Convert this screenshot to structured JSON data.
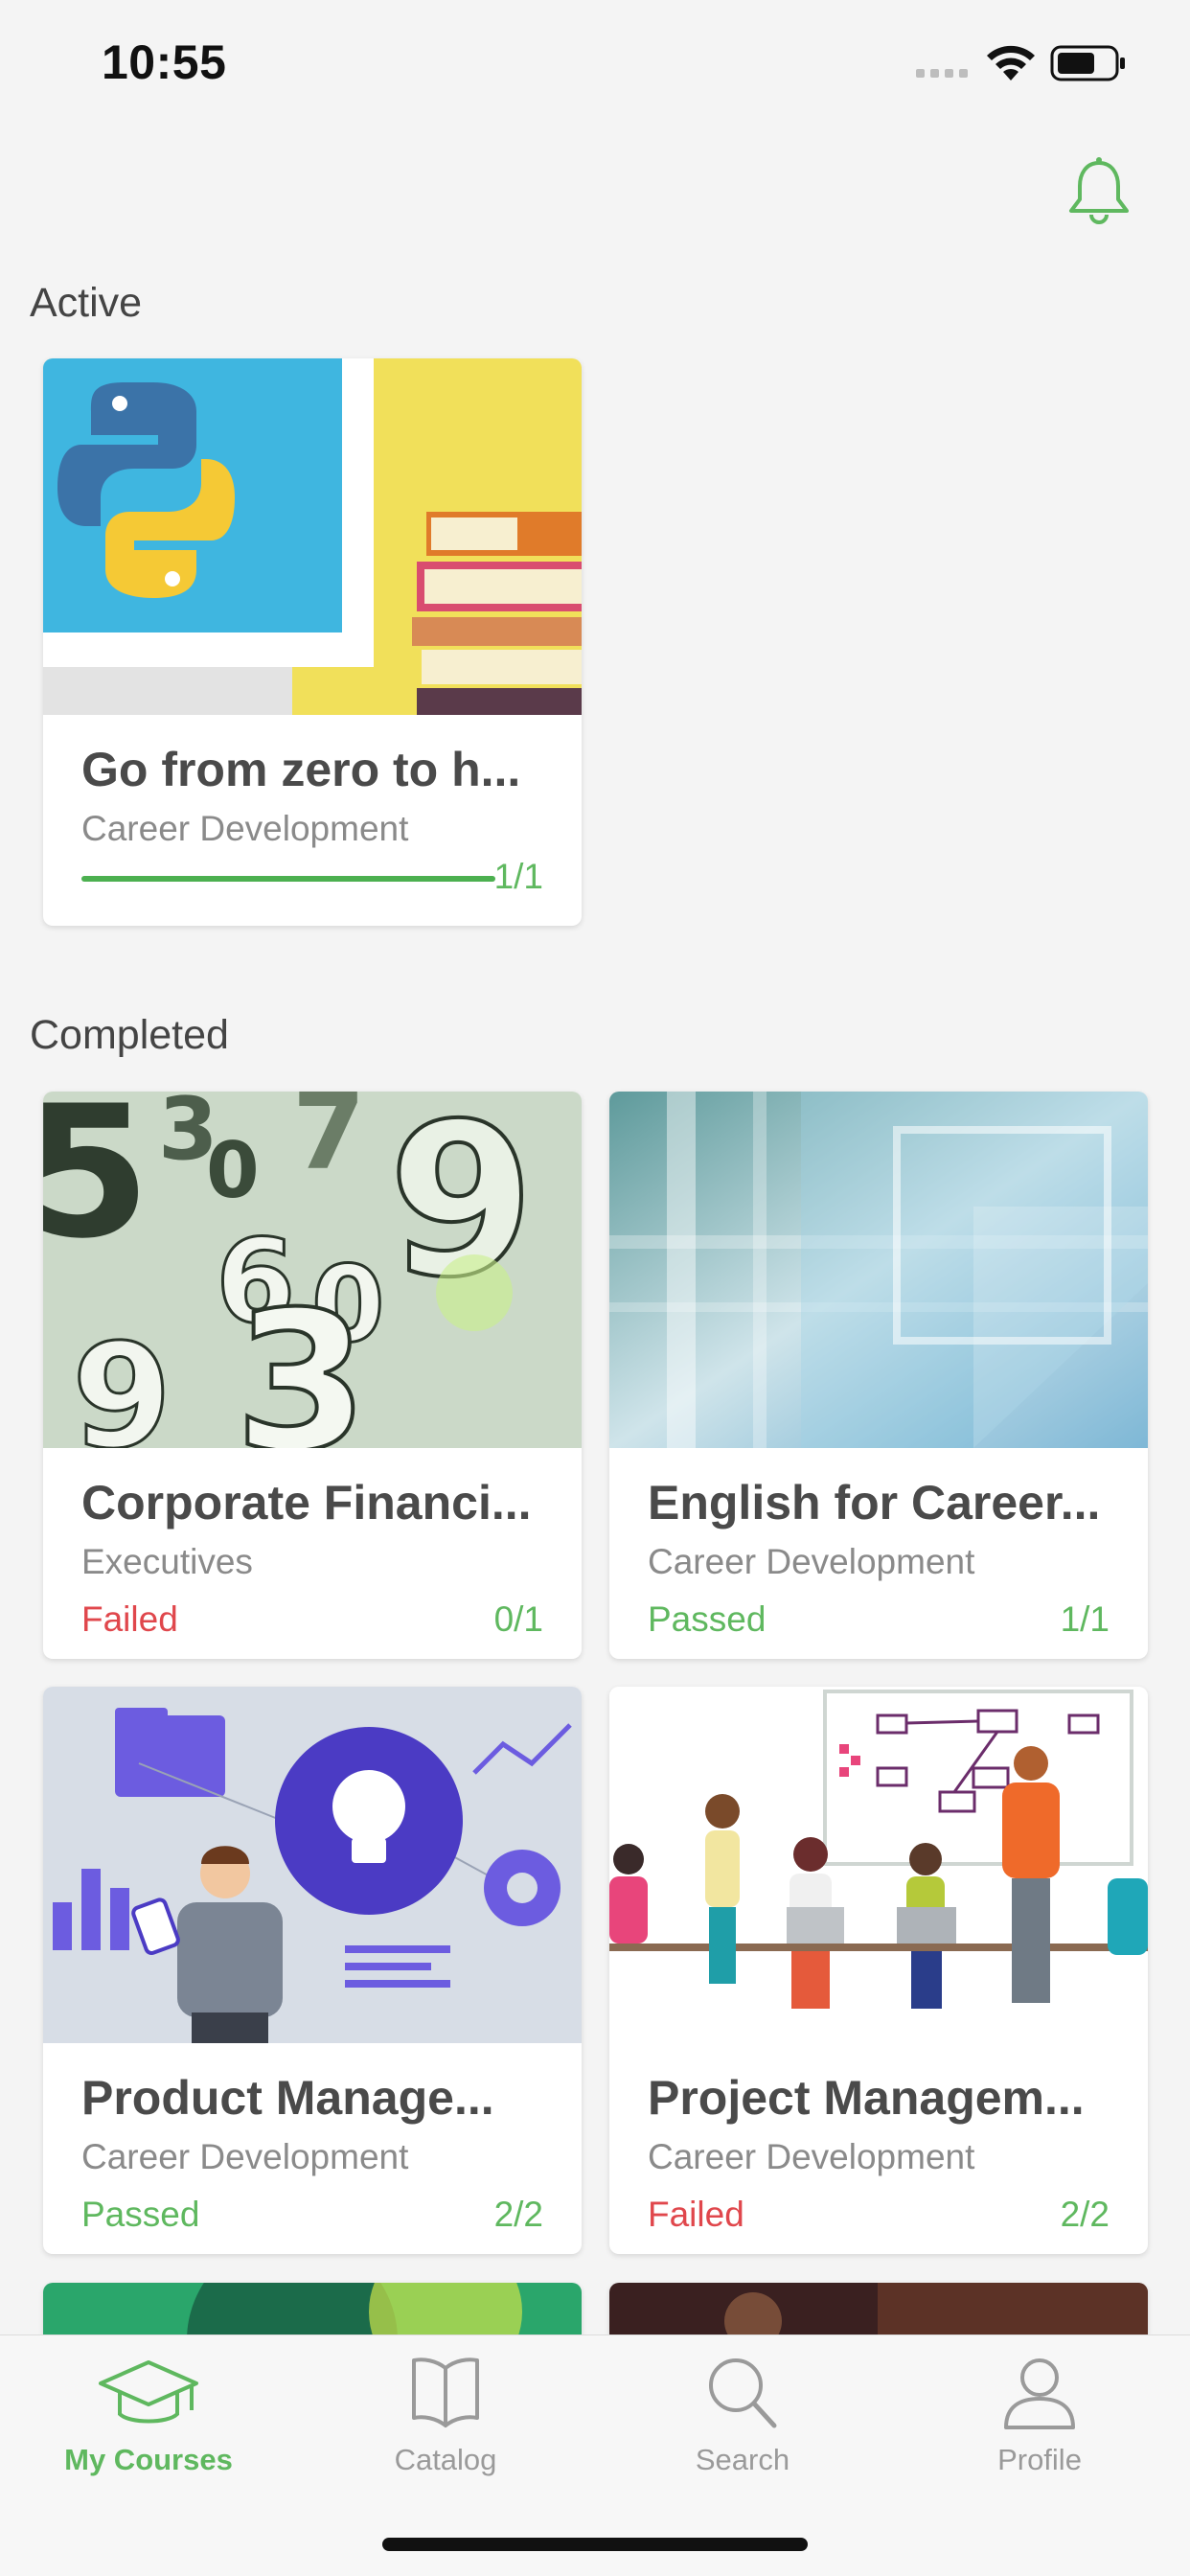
{
  "status_bar": {
    "time": "10:55"
  },
  "header": {
    "notification_icon": "bell-icon"
  },
  "sections": {
    "active": {
      "title": "Active",
      "courses": [
        {
          "title": "Go from zero to h...",
          "category": "Career Development",
          "progress": "1/1",
          "progress_fraction": 1.0
        }
      ]
    },
    "completed": {
      "title": "Completed",
      "courses": [
        {
          "title": "Corporate Financi...",
          "category": "Executives",
          "status": "Failed",
          "progress": "0/1"
        },
        {
          "title": "English for Career...",
          "category": "Career Development",
          "status": "Passed",
          "progress": "1/1"
        },
        {
          "title": "Product Manage...",
          "category": "Career Development",
          "status": "Passed",
          "progress": "2/2"
        },
        {
          "title": "Project Managem...",
          "category": "Career Development",
          "status": "Failed",
          "progress": "2/2"
        }
      ]
    }
  },
  "tab_bar": {
    "tabs": [
      {
        "label": "My Courses",
        "icon": "graduation-cap-icon",
        "active": true
      },
      {
        "label": "Catalog",
        "icon": "book-icon",
        "active": false
      },
      {
        "label": "Search",
        "icon": "search-icon",
        "active": false
      },
      {
        "label": "Profile",
        "icon": "user-icon",
        "active": false
      }
    ]
  },
  "colors": {
    "accent": "#5fb85f",
    "failed": "#e0474c",
    "background": "#f4f4f4"
  }
}
